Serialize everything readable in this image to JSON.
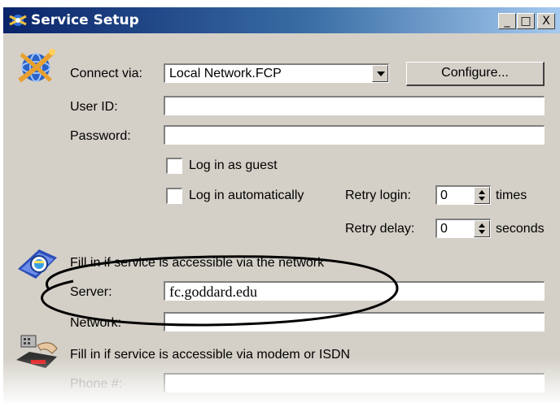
{
  "window": {
    "title": "Service Setup",
    "controls": {
      "minimize": "_",
      "maximize": "□",
      "close": "X"
    }
  },
  "connect": {
    "label": "Connect via:",
    "selected": "Local Network.FCP",
    "configure_label": "Configure..."
  },
  "userid": {
    "label": "User ID:",
    "value": ""
  },
  "password": {
    "label": "Password:",
    "value": ""
  },
  "guest": {
    "label": "Log in as guest",
    "checked": false
  },
  "auto": {
    "label": "Log in automatically",
    "checked": false
  },
  "retry_login": {
    "label": "Retry login:",
    "value": "0",
    "unit": "times"
  },
  "retry_delay": {
    "label": "Retry delay:",
    "value": "0",
    "unit": "seconds"
  },
  "network_section": {
    "heading": "Fill in if service is accessible via the network",
    "server_label": "Server:",
    "server_value": "fc.goddard.edu",
    "network_label": "Network:",
    "network_value": ""
  },
  "modem_section": {
    "heading": "Fill in if service is accessible via modem or ISDN",
    "phone_label": "Phone #:",
    "phone_value": ""
  },
  "icons": {
    "title": "service-setup-icon",
    "connect": "network-globe-icon",
    "network": "network-computer-icon",
    "modem": "modem-phone-icon"
  },
  "colors": {
    "titlebar_start": "#0a246a",
    "titlebar_end": "#a6caf0",
    "dialog_face": "#d4d0c8",
    "annotation": "#000000"
  }
}
